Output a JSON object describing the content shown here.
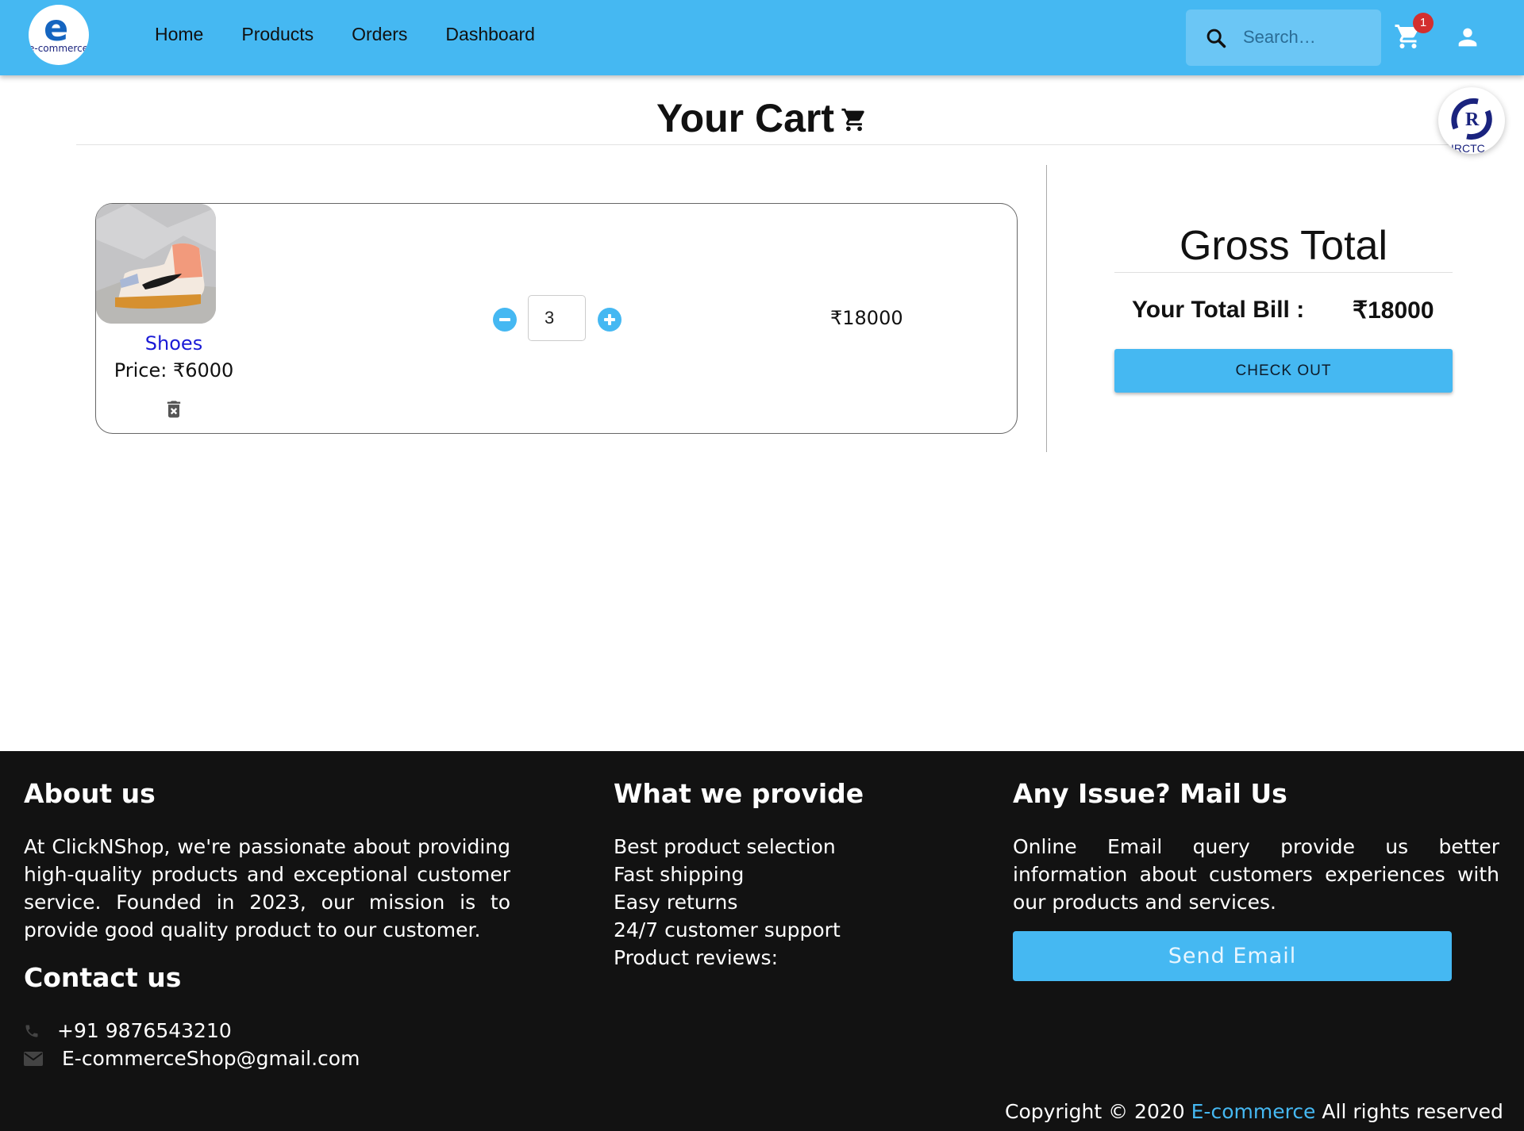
{
  "header": {
    "logo_text": "e-commerce",
    "nav": [
      "Home",
      "Products",
      "Orders",
      "Dashboard"
    ],
    "search_placeholder": "Search…",
    "cart_count": "1",
    "colors": {
      "bar": "#45b8f2",
      "badge": "#d32f2f"
    }
  },
  "page": {
    "title": "Your Cart",
    "badge_text": "IRCTC"
  },
  "cart": {
    "items": [
      {
        "name": "Shoes",
        "price_text": "Price: ₹6000",
        "quantity": "3",
        "line_total": "₹18000"
      }
    ]
  },
  "summary": {
    "title": "Gross Total",
    "bill_label": "Your Total Bill :",
    "bill_value": "₹18000",
    "checkout_label": "CHECK OUT"
  },
  "footer": {
    "about_title": "About us",
    "about_text": "At ClickNShop, we're passionate about providing high-quality products and exceptional customer service. Founded in 2023, our mission is to provide good quality product to our customer.",
    "contact_title": "Contact us",
    "phone": "+91 9876543210",
    "email": "E-commerceShop@gmail.com",
    "provide_title": "What we provide",
    "provide_items": [
      "Best product selection",
      "Fast shipping",
      "Easy returns",
      "24/7 customer support",
      "Product reviews:"
    ],
    "issue_title": "Any Issue? Mail Us",
    "issue_text": "Online Email query provide us better information about customers experiences with our products and services.",
    "send_label": "Send Email",
    "copyright_prefix": "Copyright © 2020",
    "copyright_brand": "E-commerce",
    "copyright_suffix": "All rights reserved"
  }
}
